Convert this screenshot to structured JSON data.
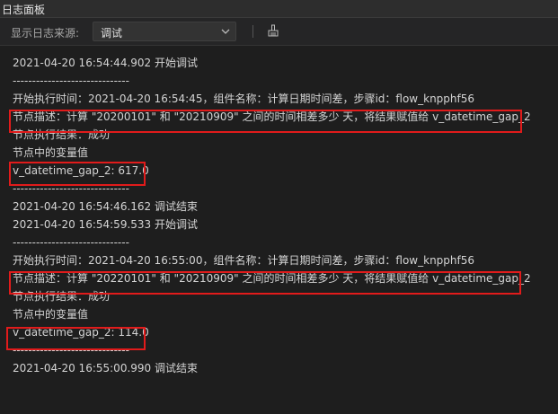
{
  "panel": {
    "title": "日志面板"
  },
  "toolbar": {
    "source_label": "显示日志来源:",
    "source_selected": "调试",
    "dropdown_icon": "chevron-down-icon",
    "clear_icon": "broom-icon"
  },
  "log_lines": [
    "2021-04-20 16:54:44.902 开始调试",
    "------------------------------",
    "开始执行时间：2021-04-20 16:54:45，组件名称：计算日期时间差，步骤id：flow_knpphf56",
    "节点描述：计算 \"20200101\" 和 \"20210909\" 之间的时间相差多少 天，将结果赋值给 v_datetime_gap_2",
    "节点执行结果：成功",
    "节点中的变量值",
    "v_datetime_gap_2: 617.0",
    "------------------------------",
    "2021-04-20 16:54:46.162 调试结束",
    "2021-04-20 16:54:59.533 开始调试",
    "------------------------------",
    "开始执行时间：2021-04-20 16:55:00，组件名称：计算日期时间差，步骤id：flow_knpphf56",
    "节点描述：计算 \"20220101\" 和 \"20210909\" 之间的时间相差多少 天，将结果赋值给 v_datetime_gap_2",
    "节点执行结果：成功",
    "节点中的变量值",
    "v_datetime_gap_2: 114.0",
    "------------------------------",
    "2021-04-20 16:55:00.990 调试结束"
  ],
  "highlight_color": "#e11b1b"
}
